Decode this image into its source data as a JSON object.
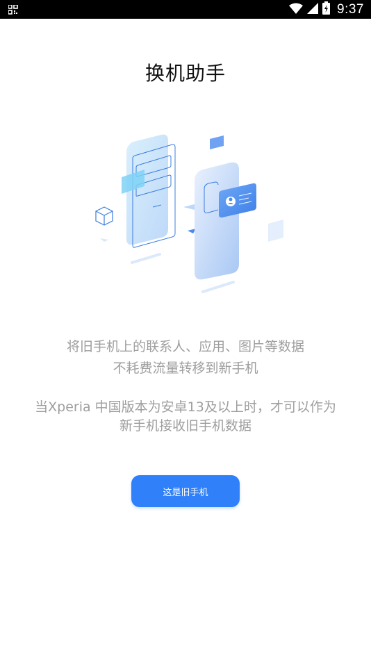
{
  "status_bar": {
    "time": "9:37",
    "left_icon": "qr-code-icon",
    "right_icons": [
      "wifi-icon",
      "cellular-signal-icon",
      "battery-icon"
    ]
  },
  "page": {
    "title": "换机助手",
    "description_line1": "将旧手机上的联系人、应用、图片等数据",
    "description_line2": "不耗费流量转移到新手机",
    "note_line1": "当Xperia 中国版本为安卓13及以上时，才可以作为",
    "note_line2": "新手机接收旧手机数据"
  },
  "actions": {
    "old_phone_button_label": "这是旧手机"
  },
  "colors": {
    "primary": "#2f80f9",
    "text_primary": "#111111",
    "text_secondary": "#9e9e9e",
    "status_bar": "#000000"
  }
}
